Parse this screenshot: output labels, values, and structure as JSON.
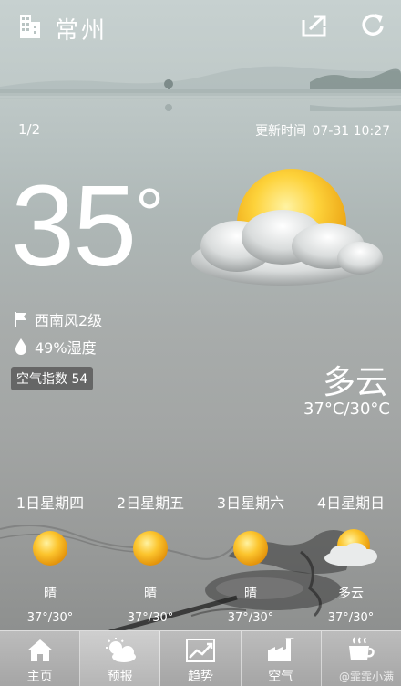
{
  "header": {
    "city": "常州",
    "building_icon": "building-icon",
    "share_icon": "share-icon",
    "refresh_icon": "refresh-icon"
  },
  "page_indicator": "1/2",
  "update": {
    "label": "更新时间",
    "datetime": "07-31 10:27"
  },
  "current": {
    "temperature": "35",
    "degree": "°",
    "wind": "西南风2级",
    "humidity": "49%湿度",
    "aqi": "空气指数 54",
    "condition": "多云",
    "temp_range": "37°C/30°C",
    "icon": "partly-cloudy-icon"
  },
  "forecast": [
    {
      "date": "1日星期四",
      "cond": "晴",
      "range": "37°/30°",
      "icon": "sun-icon"
    },
    {
      "date": "2日星期五",
      "cond": "晴",
      "range": "37°/30°",
      "icon": "sun-icon"
    },
    {
      "date": "3日星期六",
      "cond": "晴",
      "range": "37°/30°",
      "icon": "sun-icon"
    },
    {
      "date": "4日星期日",
      "cond": "多云",
      "range": "37°/30°",
      "icon": "partly-cloudy-icon"
    }
  ],
  "nav": [
    {
      "label": "主页",
      "icon": "home-icon",
      "active": false
    },
    {
      "label": "预报",
      "icon": "forecast-icon",
      "active": true
    },
    {
      "label": "趋势",
      "icon": "trend-icon",
      "active": false
    },
    {
      "label": "空气",
      "icon": "factory-icon",
      "active": false
    },
    {
      "label": "",
      "icon": "cup-icon",
      "active": false
    }
  ],
  "watermark": "@霏霏小满",
  "colors": {
    "sun": "#f4b81e",
    "bg_top": "#c7d1d0",
    "bg_bottom": "#8a8b8a"
  }
}
